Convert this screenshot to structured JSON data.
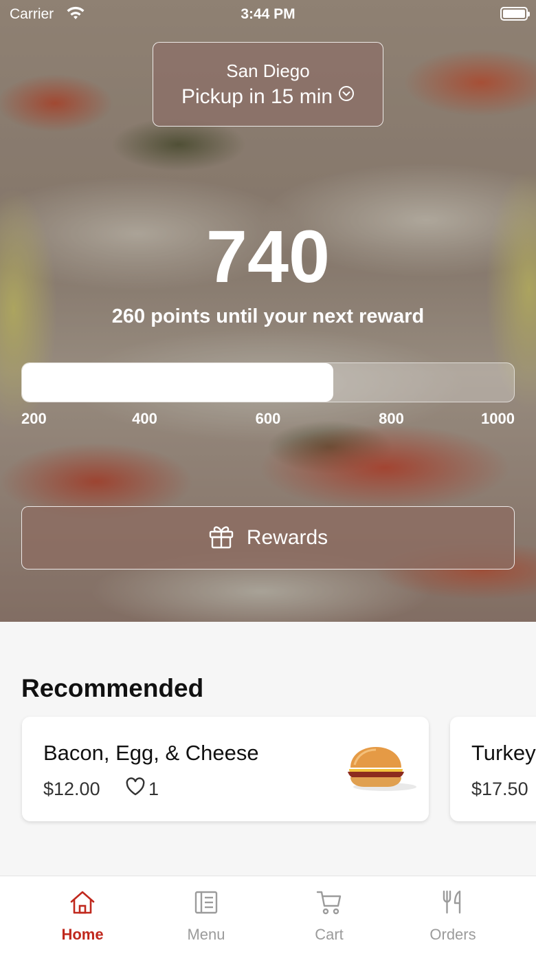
{
  "status_bar": {
    "carrier": "Carrier",
    "time": "3:44 PM"
  },
  "location": {
    "city": "San Diego",
    "pickup": "Pickup in 15 min"
  },
  "rewards": {
    "points": "740",
    "caption": "260 points until your next reward",
    "progress_fraction": 0.6333,
    "ticks": [
      "200",
      "400",
      "600",
      "800",
      "1000"
    ],
    "button_label": "Rewards"
  },
  "recommended": {
    "title": "Recommended",
    "items": [
      {
        "name": "Bacon, Egg, & Cheese",
        "price": "$12.00",
        "likes": "1"
      },
      {
        "name": "Turkey",
        "price": "$17.50"
      }
    ]
  },
  "tabbar": {
    "tabs": [
      {
        "label": "Home",
        "icon": "home-icon"
      },
      {
        "label": "Menu",
        "icon": "menu-icon"
      },
      {
        "label": "Cart",
        "icon": "cart-icon"
      },
      {
        "label": "Orders",
        "icon": "utensils-icon"
      }
    ]
  },
  "colors": {
    "accent": "#c0281d",
    "inactive": "#9b9b9b"
  }
}
